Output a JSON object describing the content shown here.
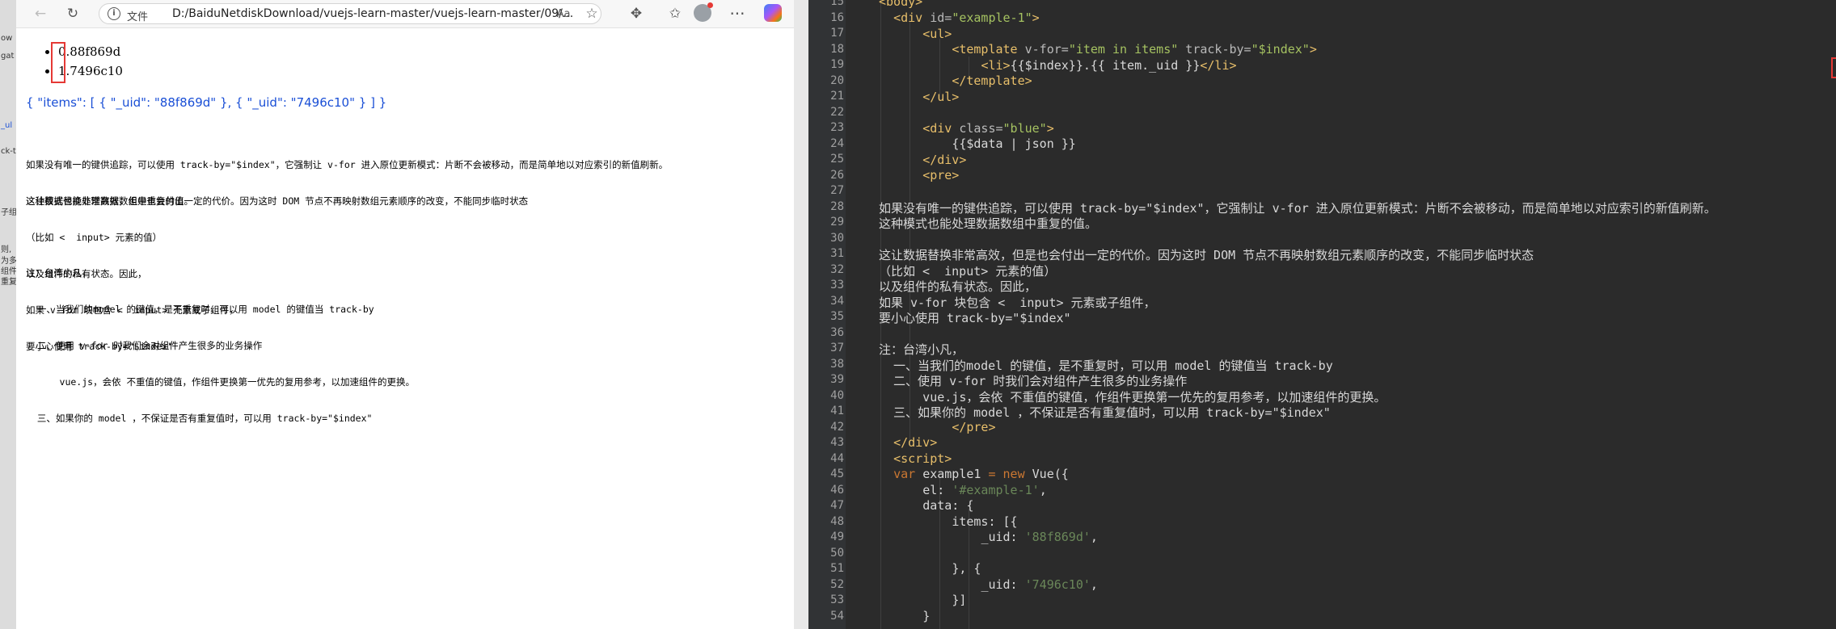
{
  "left_edge": {
    "fragments": [
      "ow",
      "gat",
      "_ul",
      "ck-t",
      "子组",
      "则,",
      "为多",
      "组件",
      "重复"
    ]
  },
  "browser": {
    "address_scheme": "文件",
    "url": "D:/BaiduNetdiskDownload/vuejs-learn-master/vuejs-learn-master/09/...",
    "icons": [
      "back-icon",
      "refresh-icon",
      "info-icon",
      "read-aloud-icon",
      "favorite-icon",
      "extensions-icon",
      "favorites-bar-icon",
      "profile-icon",
      "more-icon",
      "copilot-icon"
    ],
    "list_items": [
      "0.88f869d",
      "1.7496c10"
    ],
    "json_output": "{ \"items\": [ { \"_uid\": \"88f869d\" }, { \"_uid\": \"7496c10\" } ] }",
    "pre_lines_1": [
      "如果没有唯一的键供追踪，可以使用 track-by=\"$index\"，它强制让 v-for 进入原位更新模式：片断不会被移动，而是简单地以对应索引的新值刷新。",
      "这种模式也能处理数据数组中重复的值。"
    ],
    "pre_lines_2": [
      "这让数据替换非常高效，但是也会付出一定的代价。因为这时 DOM 节点不再映射数组元素顺序的改变，不能同步临时状态",
      "（比如 <  input> 元素的值）",
      "以及组件的私有状态。因此，",
      "如果 v-for 块包含 <  input> 元素或子组件，",
      "要小心使用 track-by=\"$index\""
    ],
    "pre_lines_3": [
      "注：台湾小凡，",
      "  一、当我们的model 的键值，是不重复时，可以用 model 的键值当 track-by",
      "  二、使用 v-for 时我们会对组件产生很多的业务操作",
      "      vue.js，会依 不重值的键值，作组件更换第一优先的复用参考，以加速组件的更换。",
      "  三、如果你的 model ，不保证是否有重复值时，可以用 track-by=\"$index\""
    ]
  },
  "editor": {
    "line_numbers": [
      15,
      16,
      17,
      18,
      19,
      20,
      21,
      22,
      23,
      24,
      25,
      26,
      27,
      28,
      29,
      30,
      31,
      32,
      33,
      34,
      35,
      36,
      37,
      38,
      39,
      40,
      41,
      42,
      43,
      44,
      45,
      46,
      47,
      48,
      49,
      50,
      51,
      52,
      53,
      54
    ],
    "l15_tag": "<body>",
    "l16_open": "<div ",
    "l16_attr": "id=",
    "l16_val": "\"example-1\"",
    "l16_close": ">",
    "l17_tag": "<ul>",
    "l18_open": "<template ",
    "l18_attr1": "v-for=",
    "l18_val1": "\"item in items\"",
    "l18_attr2": " track-by=",
    "l18_val2": "\"$index\"",
    "l18_close": ">",
    "l19_open": "<li>",
    "l19_text": "{{$index}}.{{ item._uid }}",
    "l19_close": "</li>",
    "l20_tag": "</template>",
    "l21_tag": "</ul>",
    "l23_open": "<div ",
    "l23_attr": "class=",
    "l23_val": "\"blue\"",
    "l23_close": ">",
    "l24_text": "{{$data | json }}",
    "l25_tag": "</div>",
    "l26_tag": "<pre>",
    "l28": "如果没有唯一的键供追踪，可以使用 track-by=\"$index\"，它强制让 v-for 进入原位更新模式：片断不会被移动，而是简单地以对应索引的新值刷新。",
    "l29": "这种模式也能处理数据数组中重复的值。",
    "l31": "这让数据替换非常高效，但是也会付出一定的代价。因为这时 DOM 节点不再映射数组元素顺序的改变，不能同步临时状态",
    "l32": "（比如 <  input> 元素的值）",
    "l33": "以及组件的私有状态。因此，",
    "l34": "如果 v-for 块包含 <  input> 元素或子组件，",
    "l35": "要小心使用 track-by=\"$index\"",
    "l37": "注：台湾小凡，",
    "l38": "  一、当我们的model 的键值，是不重复时，可以用 model 的键值当 track-by",
    "l39": "  二、使用 v-for 时我们会对组件产生很多的业务操作",
    "l40": "      vue.js，会依 不重值的键值，作组件更换第一优先的复用参考，以加速组件的更换。",
    "l41": "  三、如果你的 model ，不保证是否有重复值时，可以用 track-by=\"$index\"",
    "l42_tag": "</pre>",
    "l43_tag": "</div>",
    "l44_tag": "<script>",
    "l45_kw": "var ",
    "l45_name": "example1 ",
    "l45_op": "= ",
    "l45_kw2": "new ",
    "l45_rest": "Vue({",
    "l46_key": "el: ",
    "l46_val": "'#example-1'",
    "l46_end": ",",
    "l47_text": "data: {",
    "l48_text": "items: [{",
    "l49_key": "_uid: ",
    "l49_val": "'88f869d'",
    "l49_end": ",",
    "l51_text": "}, {",
    "l52_key": "_uid: ",
    "l52_val": "'7496c10'",
    "l52_end": ",",
    "l53_text": "}]",
    "l54_text": "}"
  }
}
